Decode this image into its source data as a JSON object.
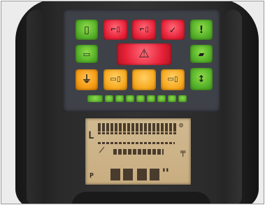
{
  "colors": {
    "ok": "#55b128",
    "alarm": "#e8233a",
    "warning": "#f59a12",
    "lcd_background": "#c8ad80",
    "bezel": "#2b2b2b"
  },
  "indicators": [
    {
      "id": "battery-indicator",
      "icon": "battery-icon",
      "color": "green"
    },
    {
      "id": "alarm-1",
      "icon": "alarm-icon",
      "color": "red"
    },
    {
      "id": "alarm-2",
      "icon": "alarm-icon",
      "color": "red"
    },
    {
      "id": "alarm-3",
      "icon": "check-icon",
      "color": "red"
    },
    {
      "id": "info-indicator",
      "icon": "exclamation-icon",
      "color": "green"
    },
    {
      "id": "charging-indicator",
      "icon": "battery-charging-icon",
      "color": "green"
    },
    {
      "id": "warning-indicator",
      "icon": "warning-triangle-icon",
      "color": "red"
    },
    {
      "id": "vehicle-indicator",
      "icon": "vehicle-icon",
      "color": "green"
    },
    {
      "id": "plug-indicator",
      "icon": "plug-icon",
      "color": "orange"
    },
    {
      "id": "level-indicator",
      "icon": "level-icon",
      "color": "orange"
    },
    {
      "id": "blank-indicator",
      "icon": "blank-icon",
      "color": "orange"
    },
    {
      "id": "temperature-indicator",
      "icon": "temperature-icon",
      "color": "orange"
    },
    {
      "id": "scroll-button",
      "icon": "up-down-arrows-icon",
      "color": "green"
    }
  ],
  "status_dots": 9,
  "lcd": {
    "label_l": "L",
    "label_p": "P"
  }
}
